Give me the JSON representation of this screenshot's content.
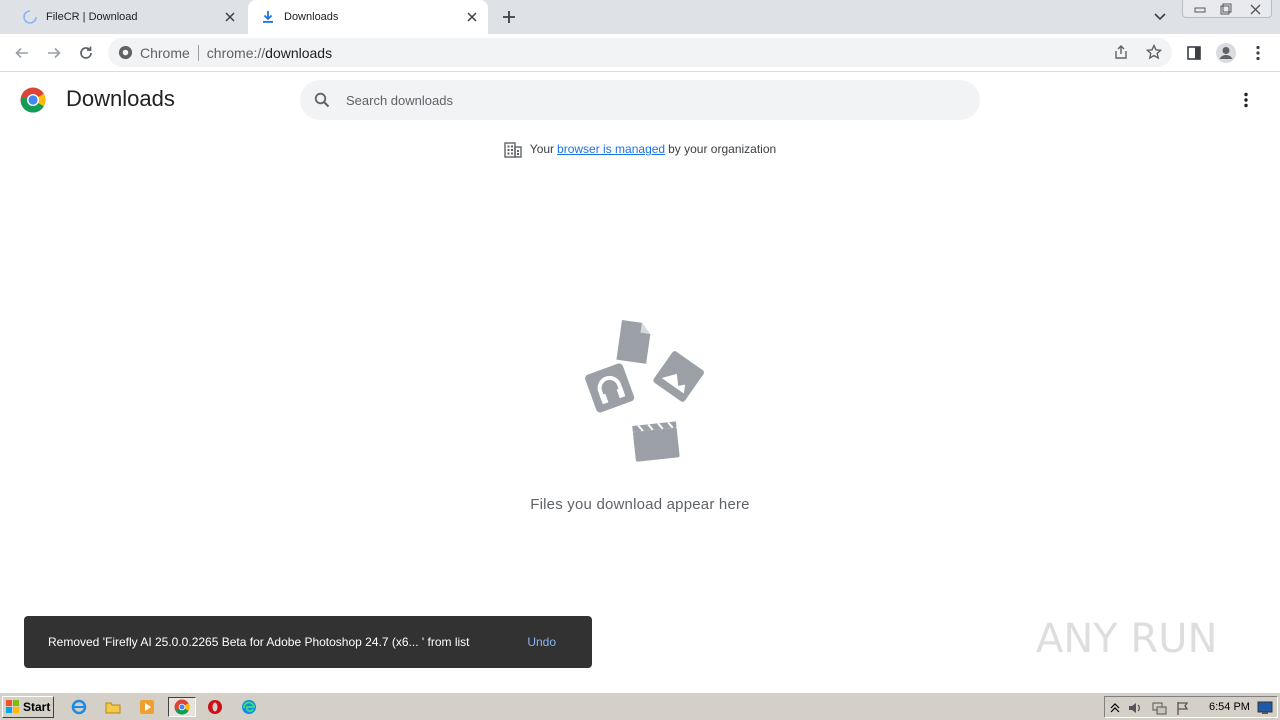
{
  "tabs": [
    {
      "title": "FileCR | Download",
      "active": false,
      "icon": "loading-spinner-icon"
    },
    {
      "title": "Downloads",
      "active": true,
      "icon": "download-icon"
    }
  ],
  "omnibox": {
    "site_label": "Chrome",
    "url_prefix": "chrome://",
    "url_host": "downloads"
  },
  "page": {
    "title": "Downloads",
    "search_placeholder": "Search downloads",
    "managed": {
      "prefix": "Your",
      "link": "browser is managed",
      "suffix": "by your organization"
    },
    "empty_text": "Files you download appear here"
  },
  "toast": {
    "message": "Removed 'Firefly AI 25.0.0.2265 Beta for Adobe Photoshop 24.7 (x6... ' from list",
    "action": "Undo"
  },
  "watermark": "ANY RUN",
  "taskbar": {
    "start_label": "Start",
    "clock": "6:54 PM",
    "apps": [
      "ie-icon",
      "explorer-icon",
      "media-player-icon",
      "chrome-icon",
      "opera-icon",
      "edge-icon"
    ]
  },
  "colors": {
    "accent": "#1a73e8",
    "tabstrip": "#dee1e6",
    "toast_bg": "#323232",
    "undo": "#8ab4f8",
    "taskbar": "#d4d0c8"
  }
}
